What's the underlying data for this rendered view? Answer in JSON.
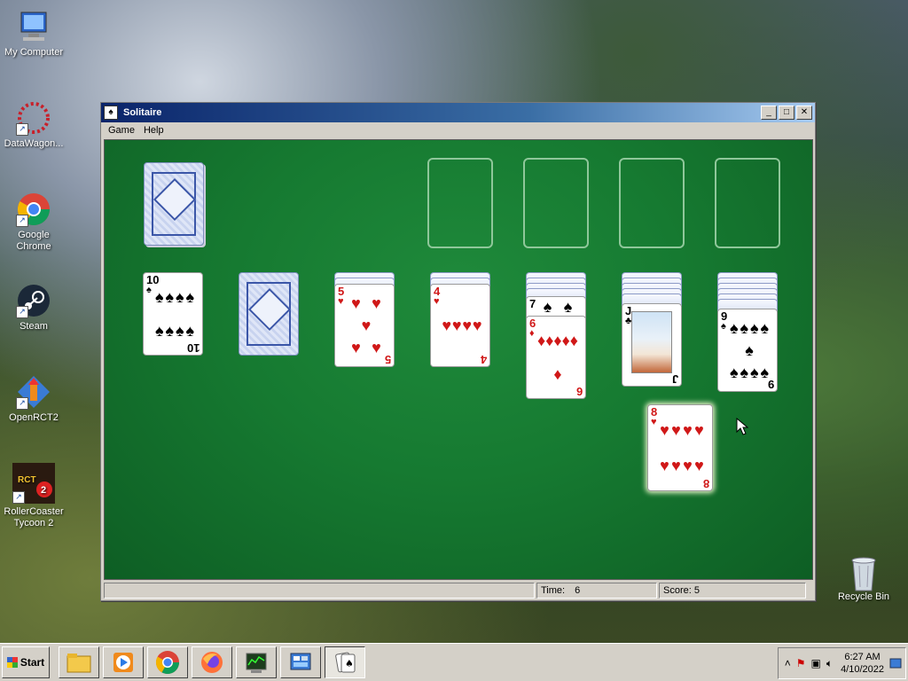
{
  "desktop": {
    "icons": [
      {
        "label": "My Computer"
      },
      {
        "label": "DataWagon..."
      },
      {
        "label": "Google Chrome"
      },
      {
        "label": "Steam"
      },
      {
        "label": "OpenRCT2"
      },
      {
        "label": "RollerCoaster Tycoon 2"
      },
      {
        "label": "Recycle Bin"
      }
    ]
  },
  "window": {
    "title": "Solitaire",
    "menu": [
      "Game",
      "Help"
    ],
    "buttons": {
      "minimize": "_",
      "maximize": "□",
      "close": "✕"
    },
    "status": {
      "time_label": "Time:",
      "time_value": "6",
      "score_label": "Score:",
      "score_value": "5"
    }
  },
  "game": {
    "stock": "face-down",
    "foundations": [
      "empty",
      "empty",
      "empty",
      "empty"
    ],
    "tableau": [
      {
        "hidden": 0,
        "face_up": [
          {
            "rank": "10",
            "suit": "♠",
            "color": "black"
          }
        ]
      },
      {
        "hidden": 1,
        "face_up": []
      },
      {
        "hidden": 2,
        "face_up": [
          {
            "rank": "5",
            "suit": "♥",
            "color": "red"
          }
        ]
      },
      {
        "hidden": 3,
        "face_up": [
          {
            "rank": "4",
            "suit": "♥",
            "color": "red"
          }
        ]
      },
      {
        "hidden": 4,
        "face_up": [
          {
            "rank": "7",
            "suit": "♠",
            "color": "black"
          },
          {
            "rank": "6",
            "suit": "♦",
            "color": "red"
          }
        ]
      },
      {
        "hidden": 5,
        "face_up": [
          {
            "rank": "J",
            "suit": "♣",
            "color": "black"
          }
        ]
      },
      {
        "hidden": 6,
        "face_up": [
          {
            "rank": "9",
            "suit": "♠",
            "color": "black"
          }
        ]
      }
    ],
    "dragging": {
      "rank": "8",
      "suit": "♥",
      "color": "red"
    }
  },
  "taskbar": {
    "start_label": "Start",
    "apps": [
      "file-explorer",
      "media-player",
      "chrome",
      "firefox",
      "task-manager",
      "control-panel",
      "solitaire"
    ],
    "clock_time": "6:27 AM",
    "clock_date": "4/10/2022"
  }
}
